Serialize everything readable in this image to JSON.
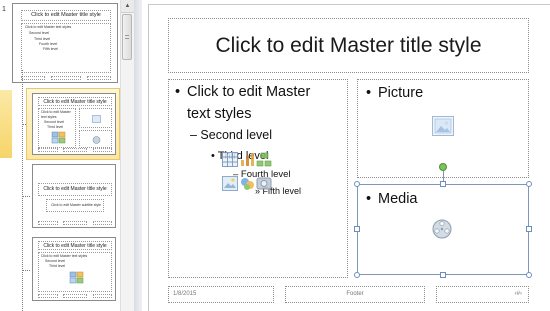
{
  "thumbnails": {
    "first_slide_number": "1",
    "items": [
      {
        "title": "Click to edit Master title style",
        "body_lines": [
          "Click to edit Master text styles",
          "Second level",
          "Third level",
          "Fourth level",
          "Fifth level"
        ]
      },
      {
        "title": "Click to edit Master title style",
        "body_lines": [
          "Click to edit Master",
          "text styles",
          "Second level",
          "Third level"
        ],
        "selected": true
      },
      {
        "title": "Click to edit Master title style",
        "subtitle": "Click to edit Master subtitle style"
      },
      {
        "title": "Click to edit Master title style",
        "body_lines": [
          "Click to edit Master text styles",
          "Second level",
          "Third level"
        ]
      }
    ]
  },
  "slide": {
    "title": "Click to edit Master title style",
    "content": {
      "level1_line1": "Click to edit Master",
      "level1_line2": "text styles",
      "level2": "– Second level",
      "level3": "Third level",
      "level4": "– Fourth level",
      "level5": "» Fifth level"
    },
    "picture_label": "Picture",
    "media_label": "Media",
    "footer": {
      "date": "1/8/2015",
      "text": "Footer",
      "number": "‹#›"
    }
  },
  "icons": {
    "bullet": "•",
    "scroll_up": "▲",
    "picture_placeholder": "picture-icon",
    "media_placeholder": "film-reel-icon",
    "insert_table": "table-icon",
    "insert_chart": "chart-icon",
    "insert_smartart": "smartart-icon",
    "insert_picture": "picture-icon",
    "insert_clipart": "clip-art-icon",
    "insert_media": "media-clip-icon"
  },
  "colors": {
    "selection_highlight": "#fde7a0",
    "selection_border": "#7e97b8",
    "rotation_handle": "#7cc35a"
  }
}
